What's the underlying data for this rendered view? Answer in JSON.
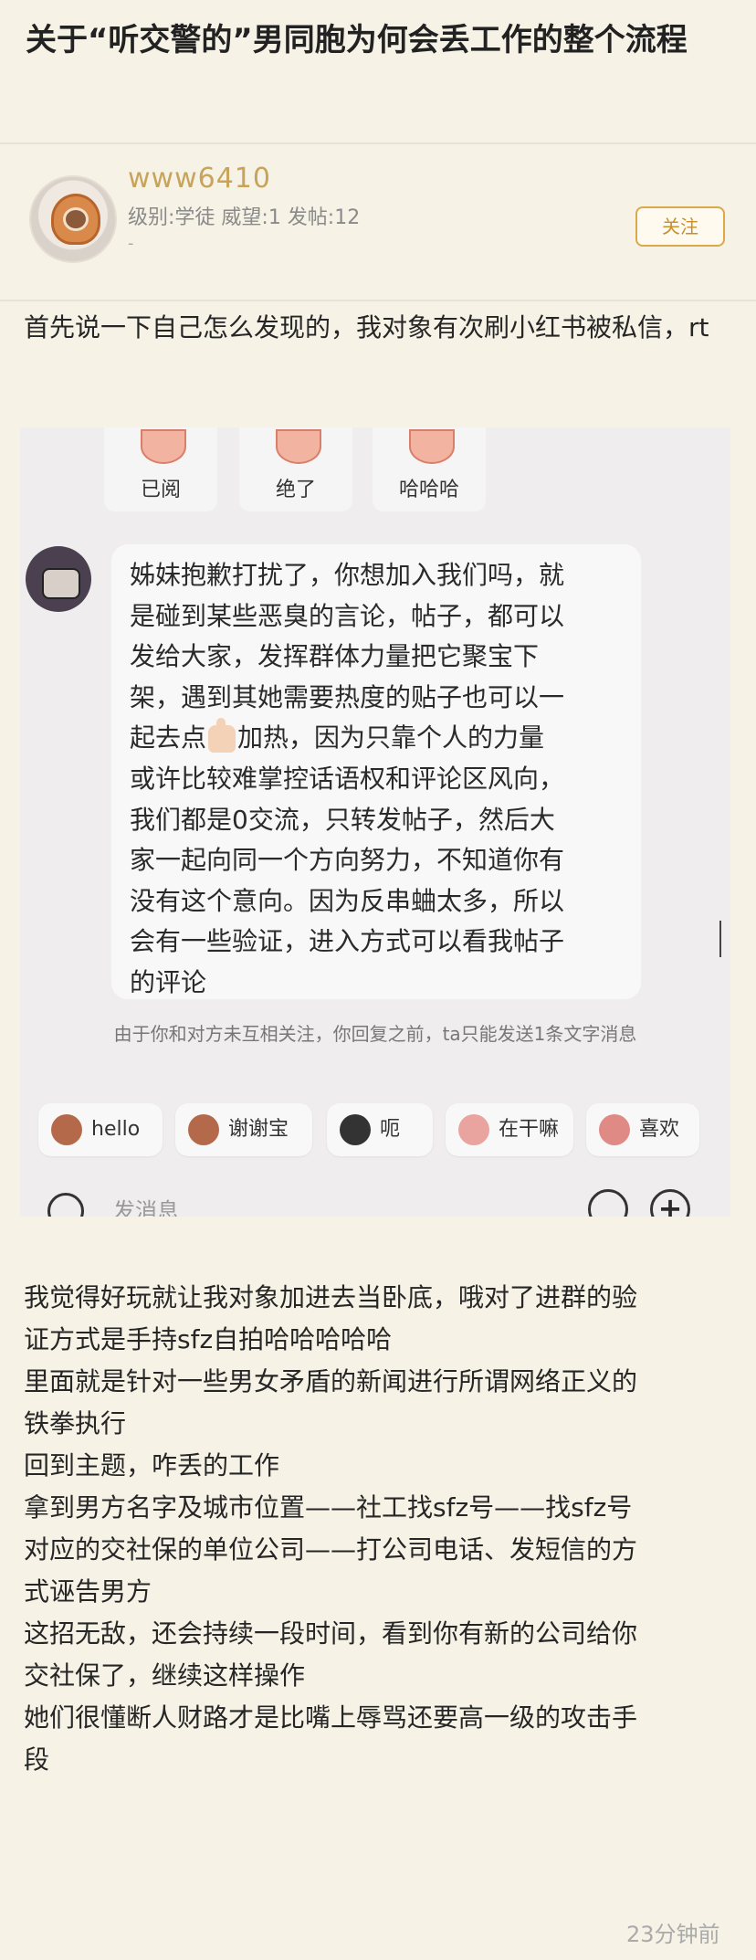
{
  "post": {
    "title": "关于“听交警的”男同胞为何会丢工作的整个流程"
  },
  "author": {
    "name": "www6410",
    "meta": "级别:学徒 威望:1 发帖:12",
    "extra": "-",
    "follow_label": "关注"
  },
  "intro": [
    "首先说一下自己怎么发现的，我对象有次刷小红书被私信，rt"
  ],
  "screenshot": {
    "quick_replies": [
      "已阅",
      "绝了",
      "哈哈哈"
    ],
    "message_lines": [
      "姊妹抱歉打扰了，你想加入我们吗，就",
      "是碰到某些恶臭的言论，帖子，都可以",
      "发给大家，发挥群体力量把它聚宝下",
      "架，遇到其她需要热度的贴子也可以一",
      "加热，因为只靠个人的力量",
      "或许比较难掌控话语权和评论区风向，",
      "我们都是0交流，只转发帖子，然后大",
      "家一起向同一个方向努力，不知道你有",
      "没有这个意向。因为反串蛐太多，所以",
      "会有一些验证，进入方式可以看我帖子",
      "的评论"
    ],
    "message_line5_prefix": "起去点",
    "notice": "由于你和对方未互相关注，你回复之前，ta只能发送1条文字消息",
    "chips": [
      "hello",
      "谢谢宝",
      "呃",
      "在干嘛",
      "喜欢"
    ],
    "input_placeholder": "发消息"
  },
  "body_lines": [
    "我觉得好玩就让我对象加进去当卧底，哦对了进群的验",
    "证方式是手持sfz自拍哈哈哈哈哈",
    "里面就是针对一些男女矛盾的新闻进行所谓网络正义的",
    "铁拳执行",
    "回到主题，咋丢的工作",
    "拿到男方名字及城市位置——社工找sfz号——找sfz号",
    "对应的交社保的单位公司——打公司电话、发短信的方",
    "式诬告男方",
    "这招无敌，还会持续一段时间，看到你有新的公司给你",
    "交社保了，继续这样操作",
    "她们很懂断人财路才是比嘴上辱骂还要高一级的攻击手",
    "段"
  ],
  "timestamp": "23分钟前"
}
